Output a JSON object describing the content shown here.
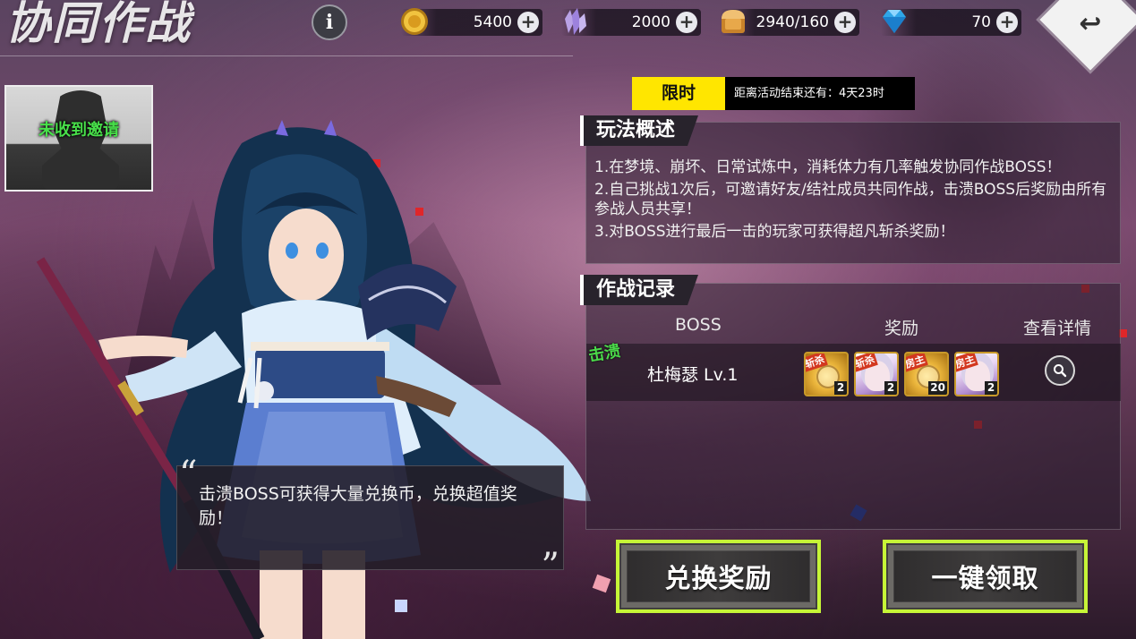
{
  "page": {
    "title": "协同作战"
  },
  "resources": [
    {
      "icon": "gold-coin-icon",
      "value": "5400"
    },
    {
      "icon": "purple-crystal-icon",
      "value": "2000"
    },
    {
      "icon": "stamina-bread-icon",
      "value": "2940/160"
    },
    {
      "icon": "blue-diamond-icon",
      "value": "70"
    }
  ],
  "info_button": {
    "label": "i"
  },
  "back_button": {
    "label": "↩"
  },
  "invite": {
    "label": "未收到邀请"
  },
  "speech": {
    "text": "击溃BOSS可获得大量兑换币，兑换超值奖励！"
  },
  "event": {
    "badge": "限时",
    "countdown_label": "距离活动结束还有：",
    "countdown_value": "4天23时"
  },
  "overview": {
    "title": "玩法概述",
    "rules": [
      "1.在梦境、崩坏、日常试炼中，消耗体力有几率触发协同作战BOSS！",
      "2.自己挑战1次后，可邀请好友/结社成员共同作战，击溃BOSS后奖励由所有参战人员共享！",
      "3.对BOSS进行最后一击的玩家可获得超凡斩杀奖励！"
    ]
  },
  "records": {
    "title": "作战记录",
    "columns": {
      "boss": "BOSS",
      "reward": "奖励",
      "detail": "查看详情"
    },
    "rows": [
      {
        "status": "击溃",
        "boss": "杜梅瑟 Lv.1",
        "rewards": [
          {
            "tag": "斩杀",
            "type": "coin",
            "count": "2"
          },
          {
            "tag": "斩杀",
            "type": "char",
            "count": "2"
          },
          {
            "tag": "房主",
            "type": "coin",
            "count": "20"
          },
          {
            "tag": "房主",
            "type": "char",
            "count": "2"
          }
        ]
      }
    ]
  },
  "buttons": {
    "exchange": "兑换奖励",
    "claim_all": "一键领取"
  },
  "colors": {
    "accent_green": "#c6f537",
    "badge_yellow": "#ffe600",
    "status_green": "#4bd94a"
  }
}
